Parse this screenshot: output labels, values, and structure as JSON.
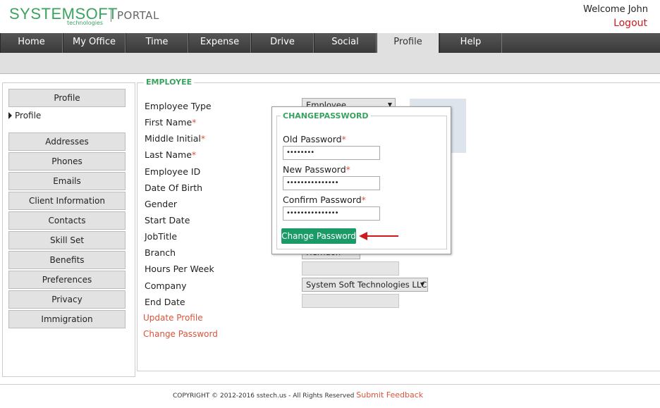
{
  "header": {
    "logo_main": "SYSTEMSOFT",
    "logo_sub": "technologies",
    "portal": "PORTAL",
    "welcome": "Welcome John",
    "logout": "Logout"
  },
  "nav": {
    "tabs": [
      "Home",
      "My Office",
      "Time",
      "Expense",
      "Drive",
      "Social",
      "Profile",
      "Help"
    ],
    "active": "Profile"
  },
  "sidebar": {
    "top_button": "Profile",
    "active_item": "Profile",
    "items": [
      "Addresses",
      "Phones",
      "Emails",
      "Client Information",
      "Contacts",
      "Skill Set",
      "Benefits",
      "Preferences",
      "Privacy",
      "Immigration"
    ]
  },
  "employee": {
    "legend": "EMPLOYEE",
    "labels": {
      "employee_type": "Employee Type",
      "first_name": "First Name",
      "middle_initial": "Middle Initial",
      "last_name": "Last Name",
      "employee_id": "Employee ID",
      "dob": "Date Of Birth",
      "gender": "Gender",
      "start_date": "Start Date",
      "jobtitle": "JobTitle",
      "branch": "Branch",
      "hours": "Hours Per Week",
      "company": "Company",
      "end_date": "End Date"
    },
    "required_mark": "*",
    "employee_type_value": "Employee",
    "branch_value": "Herndon",
    "company_value": "System Soft Technologies LLC",
    "update_profile": "Update Profile",
    "change_password": "Change Password"
  },
  "modal": {
    "title": "CHANGEPASSWORD",
    "old_label": "Old Password",
    "new_label": "New Password",
    "confirm_label": "Confirm Password",
    "old_value": "••••••••",
    "new_value": "•••••••••••••••",
    "confirm_value": "•••••••••••••••",
    "button": "Change Password",
    "accent_color": "#1a9a66",
    "arrow_color": "#d0191c"
  },
  "footer": {
    "copyright": "COPYRIGHT © 2012-2016 sstech.us - All Rights Reserved",
    "feedback": "Submit Feedback"
  }
}
